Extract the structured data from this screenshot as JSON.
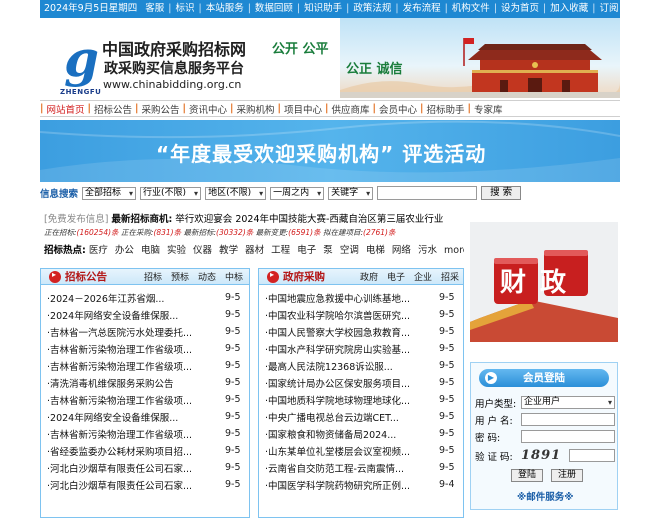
{
  "topbar": {
    "date": "2024年9月5日星期四",
    "items": [
      "客服",
      "标识",
      "本站服务",
      "数据回顾",
      "知识助手",
      "政策法规",
      "发布流程",
      "机构文件",
      "设为首页",
      "加入收藏",
      "订阅"
    ]
  },
  "header": {
    "logo_sub": "ZHENGFU",
    "title1": "中国政府采购招标网",
    "title2": "政采购买信息服务平台",
    "url": "www.chinabidding.org.cn",
    "slogan1": "公开 公平",
    "slogan2": "公正 诚信"
  },
  "nav": {
    "items": [
      "网站首页",
      "招标公告",
      "采购公告",
      "资讯中心",
      "采购机构",
      "项目中心",
      "供应商库",
      "会员中心",
      "招标助手",
      "专家库"
    ]
  },
  "banner": {
    "text": "“年度最受欢迎采购机构” 评选活动"
  },
  "search": {
    "label": "信息搜索",
    "selects": [
      "全部招标",
      "行业(不限)",
      "地区(不限)",
      "一周之内",
      "关键字"
    ],
    "button": "搜 索"
  },
  "ticker": {
    "free": "[免费发布信息]",
    "hot": "最新招标商机:",
    "text": "举行欢迎宴会 2024年中国技能大赛-西藏自治区第三届农业行业"
  },
  "stats": [
    {
      "label": "正在招标:",
      "value": "(160254)条"
    },
    {
      "label": "正在采购:",
      "value": "(831)条"
    },
    {
      "label": "最新招标:",
      "value": "(30332)条"
    },
    {
      "label": "最新变更:",
      "value": "(6591)条"
    },
    {
      "label": "拟在建项目:",
      "value": "(2761)条"
    }
  ],
  "hotwords": {
    "label": "招标热点:",
    "words": [
      "医疗",
      "办公",
      "电脑",
      "实验",
      "仪器",
      "教学",
      "器材",
      "工程",
      "电子",
      "泵",
      "空调",
      "电梯",
      "网络",
      "污水",
      "more>>"
    ]
  },
  "panel_left": {
    "title": "招标公告",
    "tabs": [
      "招标",
      "预标",
      "动态",
      "中标"
    ],
    "rows": [
      {
        "title": "·2024－2026年江苏省烟...",
        "date": "9-5"
      },
      {
        "title": "·2024年网络安全设备维保服...",
        "date": "9-5"
      },
      {
        "title": "·吉林省一汽总医院污水处理委托...",
        "date": "9-5"
      },
      {
        "title": "·吉林省新污染物治理工作省级项...",
        "date": "9-5"
      },
      {
        "title": "·吉林省新污染物治理工作省级项...",
        "date": "9-5"
      },
      {
        "title": "·清洗消毒机维保服务采购公告",
        "date": "9-5"
      },
      {
        "title": "·吉林省新污染物治理工作省级项...",
        "date": "9-5"
      },
      {
        "title": "·2024年网络安全设备维保服...",
        "date": "9-5"
      },
      {
        "title": "·吉林省新污染物治理工作省级项...",
        "date": "9-5"
      },
      {
        "title": "·省经委监委办公耗材采购项目招...",
        "date": "9-5"
      },
      {
        "title": "·河北白沙烟草有限责任公司石家...",
        "date": "9-5"
      },
      {
        "title": "·河北白沙烟草有限责任公司石家...",
        "date": "9-5"
      }
    ]
  },
  "panel_mid": {
    "title": "政府采购",
    "tabs": [
      "政府",
      "电子",
      "企业",
      "招采"
    ],
    "rows": [
      {
        "title": "·中国地震应急救援中心训练基地...",
        "date": "9-5"
      },
      {
        "title": "·中国农业科学院哈尔滨兽医研究...",
        "date": "9-5"
      },
      {
        "title": "·中国人民警察大学校园急救教育...",
        "date": "9-5"
      },
      {
        "title": "·中国水产科学研究院房山实验基...",
        "date": "9-5"
      },
      {
        "title": "·最高人民法院12368诉讼服...",
        "date": "9-5"
      },
      {
        "title": "·国家统计局办公区保安服务项目...",
        "date": "9-5"
      },
      {
        "title": "·中国地质科学院地球物理地球化...",
        "date": "9-5"
      },
      {
        "title": "·中央广播电视总台云边端CET...",
        "date": "9-5"
      },
      {
        "title": "·国家粮食和物资储备局2024...",
        "date": "9-5"
      },
      {
        "title": "·山东某单位礼堂楼层会议室视频...",
        "date": "9-5"
      },
      {
        "title": "·云南省自交防范工程-云南震情...",
        "date": "9-5"
      },
      {
        "title": "·中国医学科学院药物研究所正例...",
        "date": "9-4"
      }
    ]
  },
  "finance": {
    "chars": "财政"
  },
  "login": {
    "title": "会员登陆",
    "type_label": "用户类型:",
    "type_value": "企业用户",
    "user_label": "用 户 名:",
    "pass_label": "密    码:",
    "code_label": "验 证 码:",
    "code_value": "1891",
    "login_button": "登陆",
    "register_button": "注册",
    "mail_service": "※邮件服务※"
  }
}
